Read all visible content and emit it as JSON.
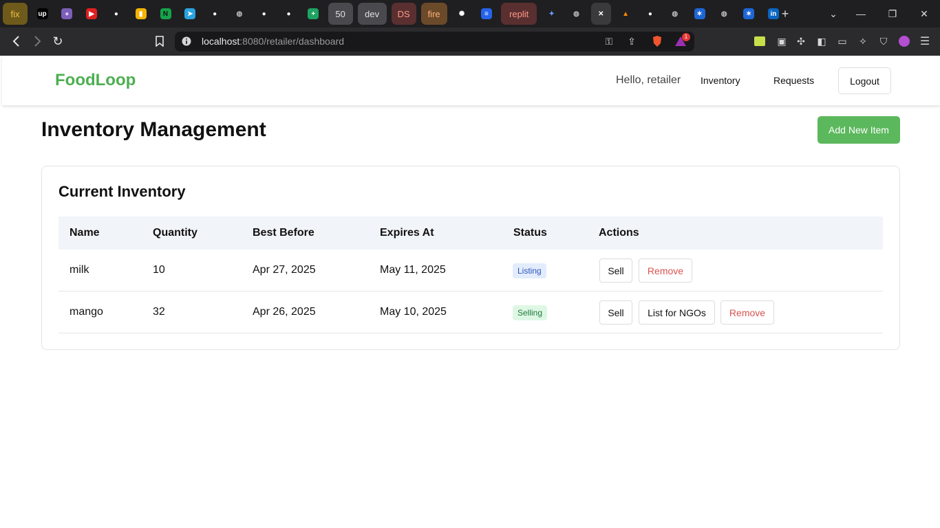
{
  "browser": {
    "tabs": [
      {
        "label": "fix",
        "bg": "#6e5a1a",
        "color": "#f0c040"
      },
      {
        "label": "",
        "icon": "upwork-icon",
        "glyph": "up",
        "fbg": "#000",
        "fcolor": "#fff"
      },
      {
        "label": "",
        "icon": "avatar-icon",
        "glyph": "●",
        "fbg": "#7b5fb8",
        "fcolor": "#e6c7ff"
      },
      {
        "label": "",
        "icon": "youtube-icon",
        "glyph": "▶",
        "fbg": "#e02020",
        "fcolor": "#fff"
      },
      {
        "label": "",
        "icon": "github-icon",
        "glyph": "●",
        "fbg": "transparent",
        "fcolor": "#fff"
      },
      {
        "label": "",
        "icon": "keep-icon",
        "glyph": "▮",
        "fbg": "#f4b400",
        "fcolor": "#fff"
      },
      {
        "label": "",
        "icon": "notion-icon",
        "glyph": "N",
        "fbg": "#16a34a",
        "fcolor": "#111"
      },
      {
        "label": "",
        "icon": "telegram-icon",
        "glyph": "➤",
        "fbg": "#2aa3df",
        "fcolor": "#fff"
      },
      {
        "label": "",
        "icon": "github-icon",
        "glyph": "●",
        "fbg": "transparent",
        "fcolor": "#fff"
      },
      {
        "label": "",
        "icon": "globe-icon",
        "glyph": "◍",
        "fbg": "transparent",
        "fcolor": "#bbb"
      },
      {
        "label": "",
        "icon": "github-icon",
        "glyph": "●",
        "fbg": "transparent",
        "fcolor": "#fff"
      },
      {
        "label": "",
        "icon": "github-icon",
        "glyph": "●",
        "fbg": "transparent",
        "fcolor": "#fff"
      },
      {
        "label": "",
        "icon": "sheets-icon",
        "glyph": "+",
        "fbg": "#1ea362",
        "fcolor": "#fff"
      },
      {
        "label": "50",
        "bg": "#4a4a4e",
        "color": "#e0e0e0"
      },
      {
        "label": "dev",
        "bg": "#4a4a4e",
        "color": "#e0e0e0"
      },
      {
        "label": "DS",
        "bg": "#5a2f2f",
        "color": "#ff9a8a"
      },
      {
        "label": "fire",
        "bg": "#6b4a2a",
        "color": "#ffb07a"
      },
      {
        "label": "",
        "icon": "openai-icon",
        "glyph": "✺",
        "fbg": "transparent",
        "fcolor": "#fff"
      },
      {
        "label": "",
        "icon": "docs-icon",
        "glyph": "≡",
        "fbg": "#2563eb",
        "fcolor": "#fff"
      },
      {
        "label": "replit",
        "bg": "#5a2f2f",
        "color": "#ff9a8a"
      },
      {
        "label": "",
        "icon": "gemini-icon",
        "glyph": "✦",
        "fbg": "transparent",
        "fcolor": "#6c9bff"
      },
      {
        "label": "",
        "icon": "globe-icon",
        "glyph": "◍",
        "fbg": "transparent",
        "fcolor": "#bbb"
      },
      {
        "label": "",
        "icon": "close-icon",
        "glyph": "✕",
        "fbg": "transparent",
        "fcolor": "#fff",
        "active": true
      },
      {
        "label": "",
        "icon": "firebase-icon",
        "glyph": "▲",
        "fbg": "transparent",
        "fcolor": "#ff8a00"
      },
      {
        "label": "",
        "icon": "github-icon",
        "glyph": "●",
        "fbg": "transparent",
        "fcolor": "#fff"
      },
      {
        "label": "",
        "icon": "globe-icon",
        "glyph": "◍",
        "fbg": "transparent",
        "fcolor": "#bbb"
      },
      {
        "label": "",
        "icon": "butterfly-icon",
        "glyph": "✶",
        "fbg": "#1d66d6",
        "fcolor": "#fff"
      },
      {
        "label": "",
        "icon": "globe-icon",
        "glyph": "◍",
        "fbg": "transparent",
        "fcolor": "#bbb"
      },
      {
        "label": "",
        "icon": "butterfly-icon",
        "glyph": "✶",
        "fbg": "#1d66d6",
        "fcolor": "#fff"
      },
      {
        "label": "",
        "icon": "linkedin-icon",
        "glyph": "in",
        "fbg": "#0a66c2",
        "fcolor": "#fff"
      }
    ],
    "new_tab": "+",
    "url_host": "localhost",
    "url_rest": ":8080/retailer/dashboard",
    "notification_count": "1"
  },
  "header": {
    "brand": "FoodLoop",
    "greeting": "Hello, retailer",
    "nav_inventory": "Inventory",
    "nav_requests": "Requests",
    "logout": "Logout"
  },
  "main": {
    "title": "Inventory Management",
    "add_button": "Add New Item",
    "card_title": "Current Inventory",
    "columns": [
      "Name",
      "Quantity",
      "Best Before",
      "Expires At",
      "Status",
      "Actions"
    ],
    "rows": [
      {
        "name": "milk",
        "quantity": "10",
        "best_before": "Apr 27, 2025",
        "expires_at": "May 11, 2025",
        "status": "Listing",
        "actions": [
          "Sell",
          "Remove"
        ]
      },
      {
        "name": "mango",
        "quantity": "32",
        "best_before": "Apr 26, 2025",
        "expires_at": "May 10, 2025",
        "status": "Selling",
        "actions": [
          "Sell",
          "List for NGOs",
          "Remove"
        ]
      }
    ]
  },
  "colors": {
    "brand": "#4caf50",
    "add_button": "#5cb85c",
    "listing_badge_bg": "#e3ecfc",
    "listing_badge_text": "#2a57b8",
    "selling_badge_bg": "#def7e5",
    "selling_badge_text": "#1f7a3a",
    "danger": "#d9534f"
  }
}
